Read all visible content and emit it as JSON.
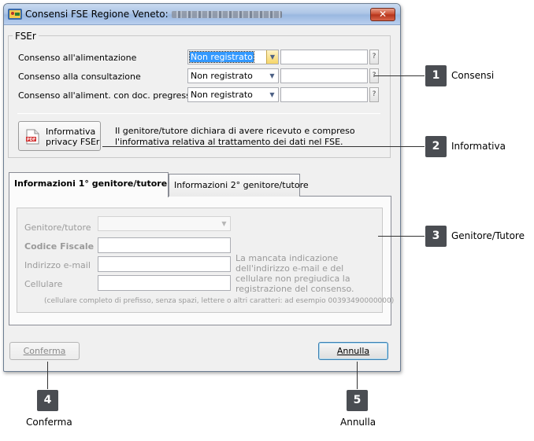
{
  "window": {
    "title": "Consensi FSE Regione Veneto:",
    "close_glyph": "✕",
    "icon": "app-icon"
  },
  "fser": {
    "legend": "FSEr",
    "rows": [
      {
        "label": "Consenso all'alimentazione",
        "value": "Non registrato",
        "help": "?"
      },
      {
        "label": "Consenso alla consultazione",
        "value": "Non registrato",
        "help": "?"
      },
      {
        "label": "Consenso all'aliment. con doc. pregressi",
        "value": "Non registrato",
        "help": "?"
      }
    ],
    "pdf_button": {
      "line1": "Informativa",
      "line2": "privacy FSEr",
      "icon_text": "PDF"
    },
    "note": "Il genitore/tutore dichiara di avere ricevuto e compreso l'informativa relativa al trattamento dei dati nel FSE."
  },
  "tabs": [
    {
      "label": "Informazioni 1° genitore/tutore"
    },
    {
      "label": "Informazioni 2° genitore/tutore"
    }
  ],
  "guardian": {
    "labels": {
      "genitore": "Genitore/tutore",
      "codice": "Codice Fiscale",
      "email": "Indirizzo e-mail",
      "cellulare": "Cellulare"
    },
    "mail_note": "La mancata indicazione dell'indirizzo e-mail e del cellulare non pregiudica la registrazione del consenso.",
    "hint": "(cellulare completo di prefisso, senza spazi, lettere o altri caratteri: ad esempio 00393490000000)"
  },
  "buttons": {
    "confirm": "Conferma",
    "cancel": "Annulla"
  },
  "callouts": [
    {
      "num": "1",
      "text": "Consensi"
    },
    {
      "num": "2",
      "text": "Informativa"
    },
    {
      "num": "3",
      "text": "Genitore/Tutore"
    },
    {
      "num": "4",
      "text": "Conferma"
    },
    {
      "num": "5",
      "text": "Annulla"
    }
  ]
}
